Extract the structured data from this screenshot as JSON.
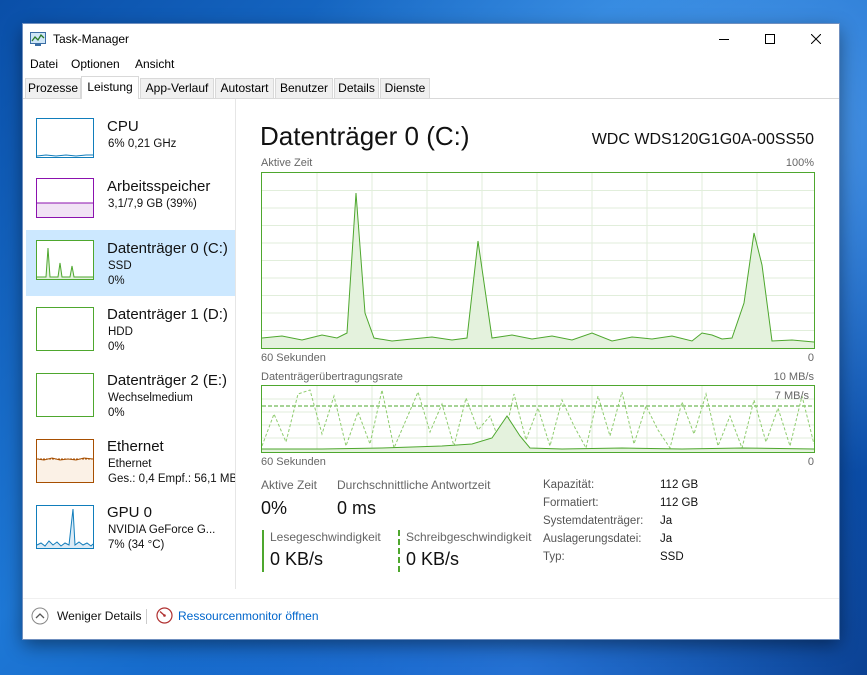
{
  "window": {
    "title": "Task-Manager"
  },
  "menu": [
    "Datei",
    "Optionen",
    "Ansicht"
  ],
  "tabs": [
    {
      "label": "Prozesse",
      "active": false
    },
    {
      "label": "Leistung",
      "active": true
    },
    {
      "label": "App-Verlauf",
      "active": false
    },
    {
      "label": "Autostart",
      "active": false
    },
    {
      "label": "Benutzer",
      "active": false
    },
    {
      "label": "Details",
      "active": false
    },
    {
      "label": "Dienste",
      "active": false
    }
  ],
  "sidebar": {
    "items": [
      {
        "name": "CPU",
        "lines": [
          "6% 0,21 GHz"
        ]
      },
      {
        "name": "Arbeitsspeicher",
        "lines": [
          "3,1/7,9 GB (39%)"
        ]
      },
      {
        "name": "Datenträger 0 (C:)",
        "lines": [
          "SSD",
          "0%"
        ],
        "selected": true
      },
      {
        "name": "Datenträger 1 (D:)",
        "lines": [
          "HDD",
          "0%"
        ]
      },
      {
        "name": "Datenträger 2 (E:)",
        "lines": [
          "Wechselmedium",
          "0%"
        ]
      },
      {
        "name": "Ethernet",
        "lines": [
          "Ethernet",
          "Ges.: 0,4 Empf.: 56,1 MB"
        ]
      },
      {
        "name": "GPU 0",
        "lines": [
          "NVIDIA GeForce G...",
          "7% (34 °C)"
        ]
      }
    ]
  },
  "detail": {
    "title": "Datenträger 0 (C:)",
    "model": "WDC WDS120G1G0A-00SS50",
    "graph1": {
      "label": "Aktive Zeit",
      "max": "100%",
      "time": "60 Sekunden",
      "end": "0"
    },
    "graph2": {
      "label": "Datenträgerübertragungsrate",
      "max": "10 MB/s",
      "inner": "7 MB/s",
      "time": "60 Sekunden",
      "end": "0"
    },
    "stats": {
      "active_label": "Aktive Zeit",
      "active_value": "0%",
      "resp_label": "Durchschnittliche Antwortzeit",
      "resp_value": "0 ms",
      "read_label": "Lesegeschwindigkeit",
      "read_value": "0 KB/s",
      "write_label": "Schreibgeschwindigkeit",
      "write_value": "0 KB/s"
    },
    "props": [
      {
        "k": "Kapazität:",
        "v": "112 GB"
      },
      {
        "k": "Formatiert:",
        "v": "112 GB"
      },
      {
        "k": "Systemdatenträger:",
        "v": "Ja"
      },
      {
        "k": "Auslagerungsdatei:",
        "v": "Ja"
      },
      {
        "k": "Typ:",
        "v": "SSD"
      }
    ]
  },
  "footer": {
    "less_details": "Weniger Details",
    "resmon": "Ressourcenmonitor öffnen"
  },
  "colors": {
    "disk": "#4ea72e",
    "cpu": "#117dbb",
    "mem": "#8b12ae",
    "net": "#a74f01",
    "select": "#cce8ff",
    "link": "#0066cc"
  }
}
